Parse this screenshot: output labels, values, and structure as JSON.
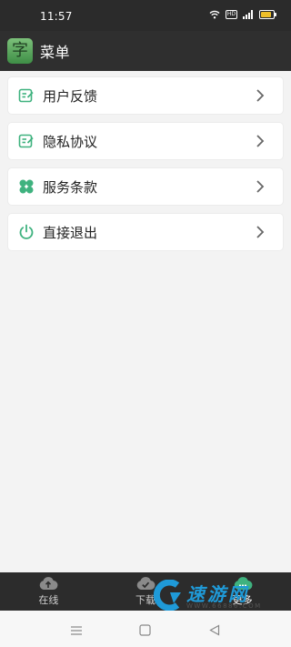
{
  "status_bar": {
    "time": "11:57",
    "hd_label": "HD",
    "battery_level": 0.85
  },
  "header": {
    "title": "菜单",
    "logo_glyph": "字"
  },
  "menu": {
    "items": [
      {
        "label": "用户反馈",
        "icon": "edit-note-icon"
      },
      {
        "label": "隐私协议",
        "icon": "edit-note-icon"
      },
      {
        "label": "服务条款",
        "icon": "four-leaf-icon"
      },
      {
        "label": "直接退出",
        "icon": "power-icon"
      }
    ]
  },
  "tabs": {
    "items": [
      {
        "label": "在线",
        "icon": "cloud-upload-icon"
      },
      {
        "label": "下载",
        "icon": "cloud-check-icon"
      },
      {
        "label": "更多",
        "icon": "cloud-more-icon"
      }
    ],
    "active_index": 2
  },
  "watermark": {
    "text": "速游网",
    "sub": "WWW.66886.COM"
  },
  "colors": {
    "accent": "#3fb27f",
    "header_bg": "#2f2f2f",
    "statusbar_bg": "#2b2b2b",
    "tabbar_bg": "#2c2c2c",
    "page_bg": "#f3f3f3",
    "battery": "#f0c02a"
  }
}
